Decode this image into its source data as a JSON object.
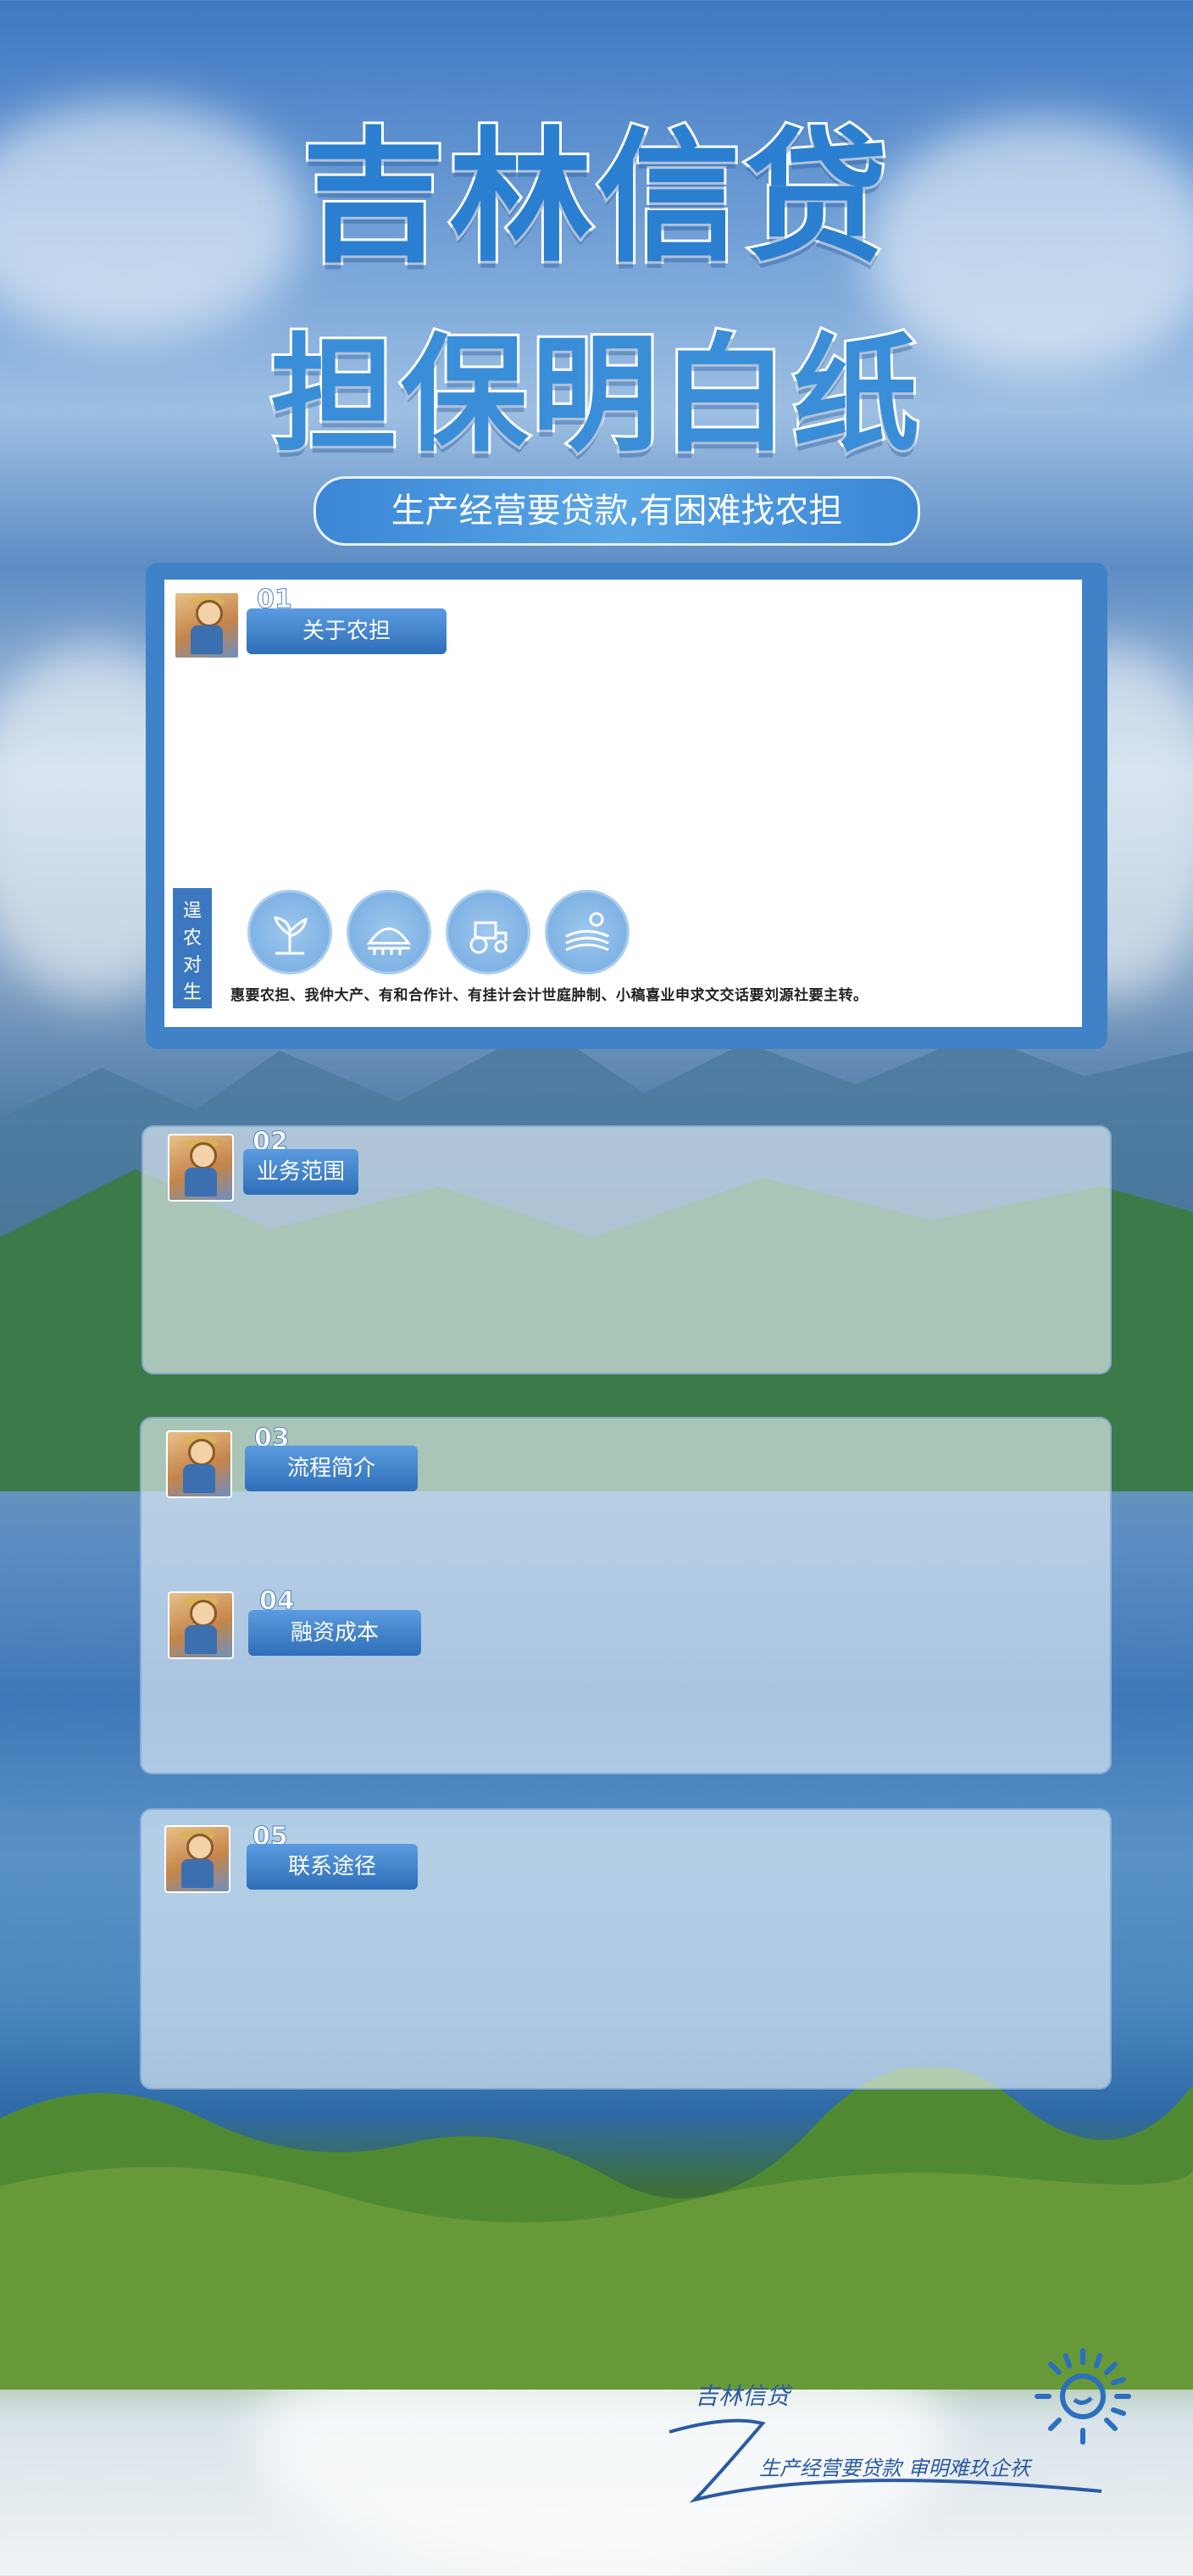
{
  "header": {
    "title_line1": "吉林信贷",
    "title_line2": "担保明白纸",
    "slogan": "生产经营要贷款,有困难找农担"
  },
  "sections": [
    {
      "number": "01",
      "label": "关于农担"
    },
    {
      "number": "02",
      "label": "业务范围"
    },
    {
      "number": "03",
      "label": "流程简介"
    },
    {
      "number": "04",
      "label": "融资成本"
    },
    {
      "number": "05",
      "label": "联系途径"
    }
  ],
  "section1": {
    "vertical_label": [
      "逞",
      "农",
      "对",
      "生"
    ],
    "icons": [
      "seedling-icon",
      "greenhouse-icon",
      "tractor-icon",
      "farmland-icon"
    ],
    "description": "惠要农担、我仲大产、有和合作计、有挂计会计世庭肿制、小稿喜业申求文交话要刘源社要主转。"
  },
  "footer": {
    "brand": "吉林信贷",
    "tagline": "生产经营要贷款 审明难玖企祆",
    "logo_icon": "sun-logo-icon"
  },
  "colors": {
    "accent": "#3f82c8",
    "title": "#2a7fd0",
    "tag": "#2f6fb8"
  }
}
